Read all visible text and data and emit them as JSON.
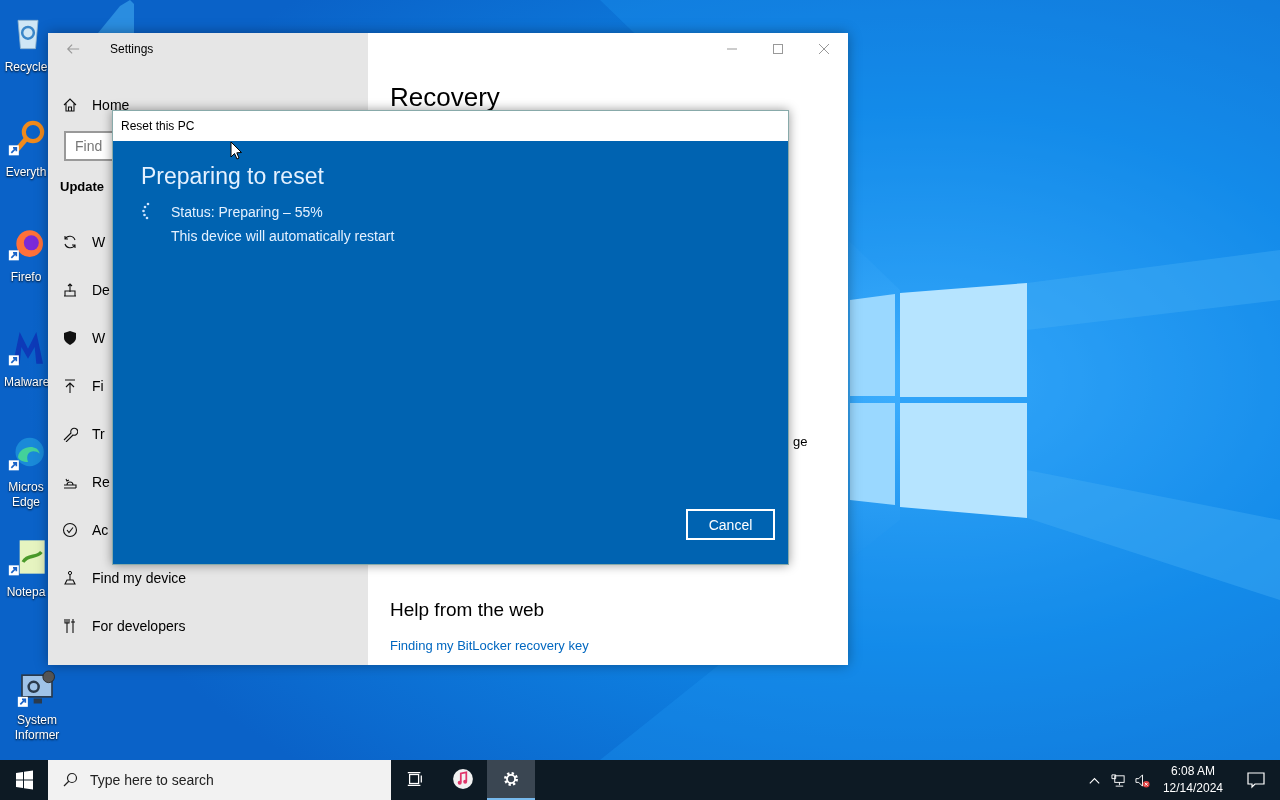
{
  "desktop": {
    "icons": [
      {
        "kind": "recycle",
        "label": "Recycle"
      },
      {
        "kind": "magnifier",
        "label": "Everyth"
      },
      {
        "kind": "firefox",
        "label": "Firefo"
      },
      {
        "kind": "malware",
        "label": "Malware"
      },
      {
        "kind": "edge",
        "label": "Micros Edge"
      },
      {
        "kind": "notepad",
        "label": "Notepa"
      },
      {
        "kind": "system",
        "label": "System Informer"
      }
    ]
  },
  "settings_window": {
    "title": "Settings",
    "sidebar": {
      "home": "Home",
      "search": {
        "placeholder": "Find"
      },
      "section": "Update",
      "items": [
        {
          "kind": "sync",
          "label": "W"
        },
        {
          "kind": "delivery",
          "label": "De"
        },
        {
          "kind": "shield",
          "label": "W"
        },
        {
          "kind": "backup",
          "label": "Fi"
        },
        {
          "kind": "wrench",
          "label": "Tr"
        },
        {
          "kind": "recovery",
          "label": "Re"
        },
        {
          "kind": "activation",
          "label": "Ac"
        },
        {
          "kind": "find",
          "label": "Find my device"
        },
        {
          "kind": "developers",
          "label": "For developers"
        }
      ]
    },
    "content": {
      "heading": "Recovery",
      "fragment": "ge",
      "help_heading": "Help from the web",
      "link": "Finding my BitLocker recovery key"
    }
  },
  "dialog": {
    "title": "Reset this PC",
    "heading": "Preparing to reset",
    "status": "Status: Preparing – 55%",
    "note": "This device will automatically restart",
    "button": "Cancel"
  },
  "taskbar": {
    "search_placeholder": "Type here to search",
    "apps": [
      {
        "kind": "task-view",
        "selected": false
      },
      {
        "kind": "music",
        "selected": false
      },
      {
        "kind": "settings",
        "selected": true
      }
    ],
    "time": "6:08 AM",
    "date": "12/14/2024"
  }
}
